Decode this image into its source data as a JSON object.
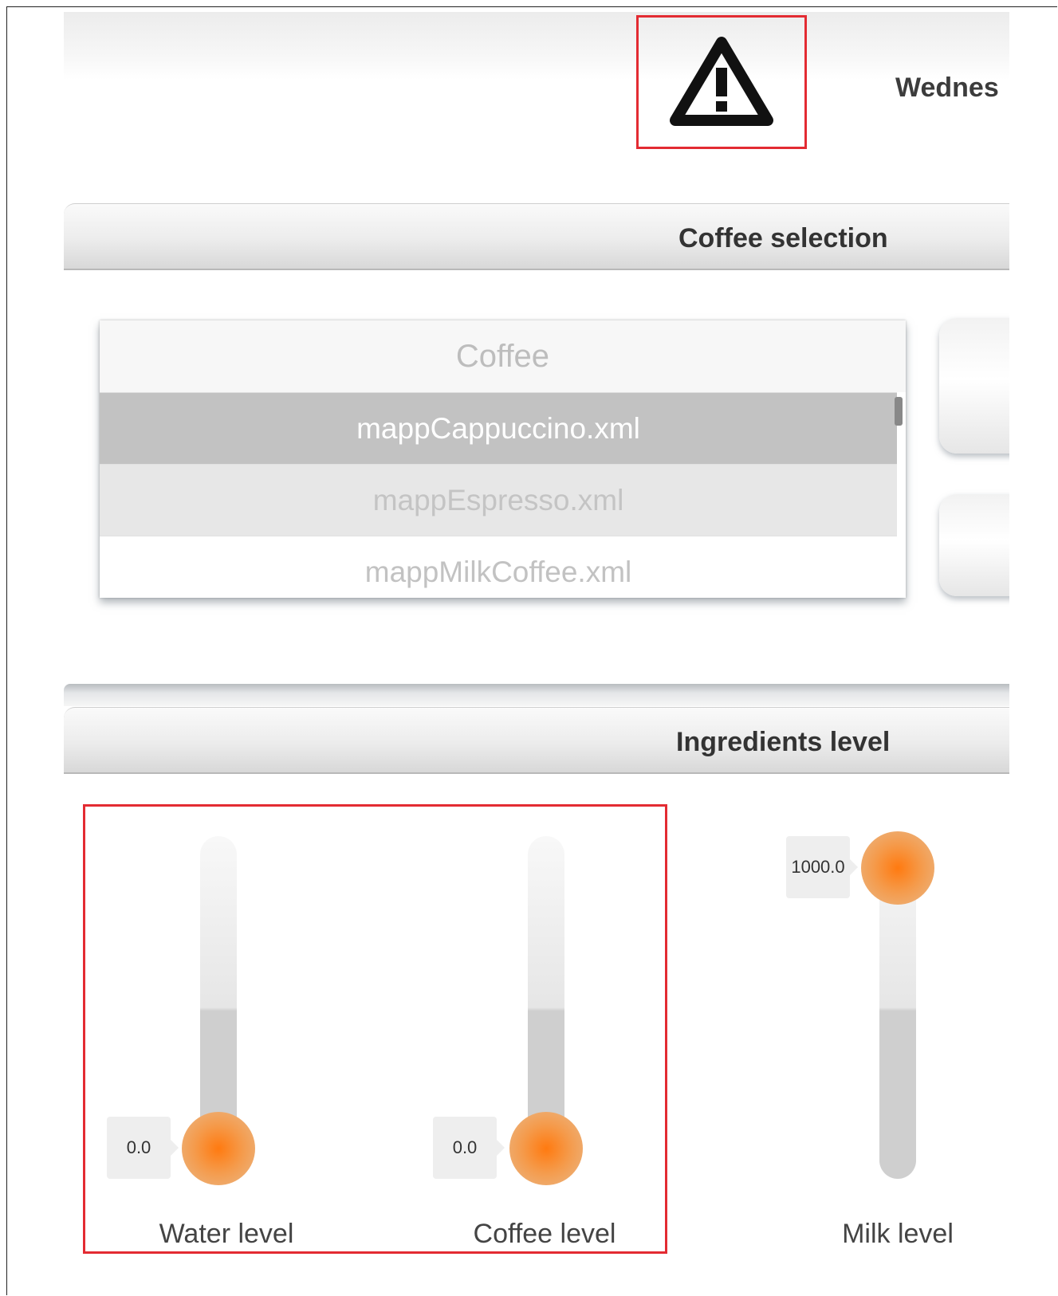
{
  "header": {
    "date_text": "Wednes",
    "warning_icon": "warning-triangle-icon"
  },
  "coffee_selection": {
    "title": "Coffee selection",
    "list_header": "Coffee",
    "items": [
      {
        "label": "mappCappuccino.xml",
        "selected": true
      },
      {
        "label": "mappEspresso.xml",
        "selected": false
      },
      {
        "label": "mappMilkCoffee.xml",
        "selected": false
      }
    ]
  },
  "ingredients": {
    "title": "Ingredients level",
    "sliders": [
      {
        "label": "Water level",
        "value_text": "0.0",
        "value": 0,
        "max": 1000
      },
      {
        "label": "Coffee level",
        "value_text": "0.0",
        "value": 0,
        "max": 1000
      },
      {
        "label": "Milk level",
        "value_text": "1000.0",
        "value": 1000,
        "max": 1000
      }
    ]
  },
  "colors": {
    "highlight": "#e32b32",
    "knob": "#ff7a10"
  }
}
